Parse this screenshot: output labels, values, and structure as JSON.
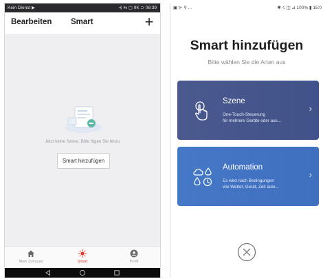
{
  "left_screen": {
    "status_bar": {
      "left": "Kein Dienst ▶",
      "right": "⊰ ⇆ ▢ 9K ⊃ 08:39"
    },
    "header": {
      "edit_label": "Bearbeiten",
      "title": "Smart",
      "add_icon": "plus-icon"
    },
    "empty_state": {
      "illustration": "smart-empty-illustration",
      "message": "Jetzt keine Szene. Bitte fügen Sie hinzu",
      "button_label": "Smart hinzufügen"
    },
    "tabs": [
      {
        "label": "Mein Zuhause",
        "icon": "home-icon",
        "active": false
      },
      {
        "label": "Smart",
        "icon": "sun-icon",
        "active": true
      },
      {
        "label": "Profil",
        "icon": "profile-icon",
        "active": false
      }
    ],
    "nav": [
      "back-icon",
      "home-circle-icon",
      "recents-icon"
    ]
  },
  "right_screen": {
    "status_bar": {
      "left": "▣ ⊳ ⚲ ...",
      "right": "✱ ☇ ◫ ⊿ 100% ▮ 15:0"
    },
    "title": "Smart hinzufügen",
    "subtitle": "Bitte wählen Sie die Arten aus",
    "cards": [
      {
        "title": "Szene",
        "desc_line1": "One-Touch-Steuerung",
        "desc_line2": "für mehrere Geräte oder aus...",
        "icon": "tap-hand-icon"
      },
      {
        "title": "Automation",
        "desc_line1": "Es wird nach Bedingungen",
        "desc_line2": "wie Wetter, Gerät, Zeit auto...",
        "icon": "weather-clock-icon"
      }
    ],
    "close_icon": "close-circle-icon"
  },
  "colors": {
    "accent_red": "#e23a2c",
    "scene_card": "#4a5a8f",
    "automation_card": "#4678c8"
  }
}
